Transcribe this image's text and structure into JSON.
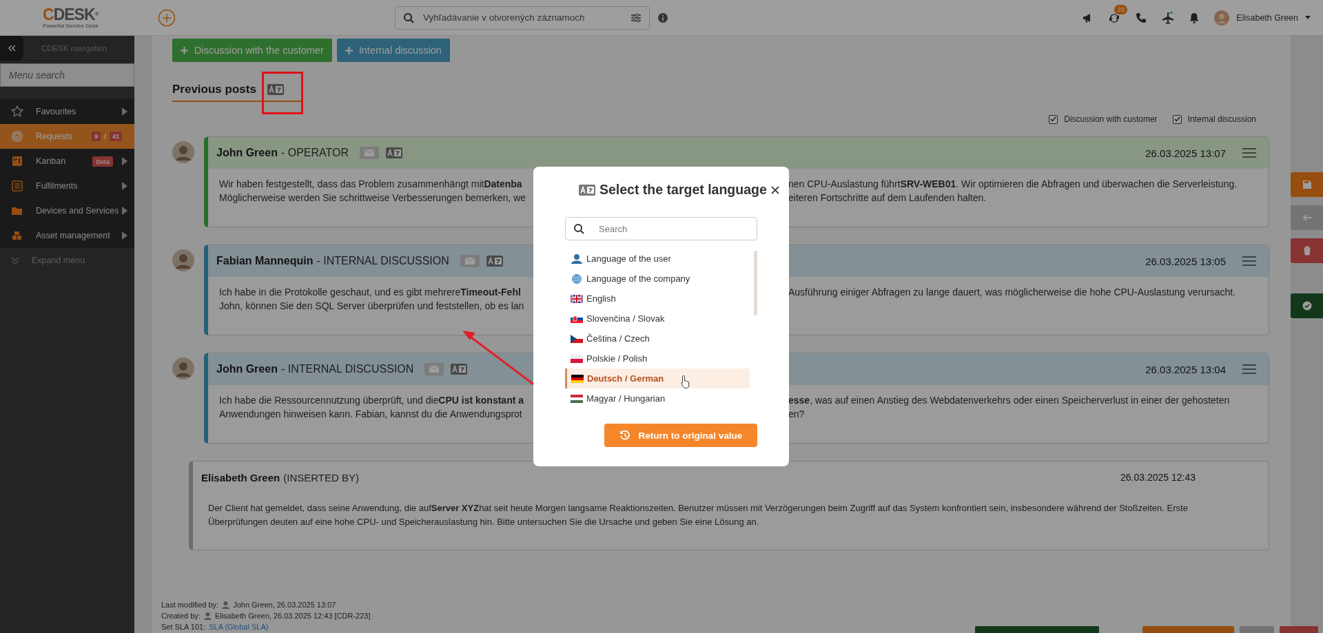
{
  "topbar": {
    "logo": {
      "accent": "C",
      "rest": "DESK",
      "mark": "®",
      "tagline": "Powerful Service Desk"
    },
    "search": {
      "placeholder": "Vyhľadávanie v otvorených záznamoch"
    },
    "sync_badge": "20",
    "user": "Elisabeth Green"
  },
  "sidebar": {
    "title": "CDESK navigation",
    "search": {
      "placeholder": "Menu search"
    },
    "items": [
      {
        "label": "Favourites",
        "kind": "star",
        "selected": false,
        "submenu": true
      },
      {
        "label": "Requests",
        "kind": "requests",
        "selected": true,
        "submenu": false,
        "counts": [
          "9",
          "/",
          "41"
        ]
      },
      {
        "label": "Kanban",
        "kind": "kanban",
        "selected": false,
        "submenu": true,
        "tag": "Beta"
      },
      {
        "label": "Fulfilments",
        "kind": "list",
        "selected": false,
        "submenu": true
      },
      {
        "label": "Devices and Services",
        "kind": "folder",
        "selected": false,
        "submenu": true
      },
      {
        "label": "Asset management",
        "kind": "boxes",
        "selected": false,
        "submenu": true
      }
    ],
    "expand": "Expand menu"
  },
  "actions": [
    {
      "label": "Discussion with the customer",
      "kind": "customer"
    },
    {
      "label": "Internal discussion",
      "kind": "internal"
    }
  ],
  "section_title": "Previous posts",
  "filters": [
    {
      "label": "Discussion with customer",
      "checked": true
    },
    {
      "label": "Internal discussion",
      "checked": true
    }
  ],
  "posts": [
    {
      "kind": "customer",
      "author": "John Green",
      "role": "- OPERATOR",
      "date": "26.03.2025 13:07",
      "lines": [
        {
          "left": "Wir haben festgestellt, dass das Problem zusammenhängt mit**Datenba**",
          "right": "nen CPU-Auslastung führt**SRV-WEB01**. Wir optimieren die Abfragen und überwachen die Serverleistung."
        },
        {
          "left": "Möglicherweise werden Sie schrittweise Verbesserungen bemerken, we",
          "right": "eiteren Fortschritte auf dem Laufenden halten."
        }
      ]
    },
    {
      "kind": "internal",
      "author": "Fabian Mannequin",
      "role": "- INTERNAL DISCUSSION",
      "date": "26.03.2025 13:05",
      "lines": [
        {
          "left": "Ich habe in die Protokolle geschaut, und es gibt mehrere**Timeout-Fehl**",
          "right": "Ausführung einiger Abfragen zu lange dauert, was möglicherweise die hohe CPU-Auslastung verursacht."
        },
        {
          "left": "John, können Sie den SQL Server überprüfen und feststellen, ob es lan"
        }
      ]
    },
    {
      "kind": "internal",
      "author": "John Green",
      "role": "- INTERNAL DISCUSSION",
      "date": "26.03.2025 13:04",
      "lines": [
        {
          "left": "Ich habe die Ressourcennutzung überprüft, und die**CPU ist konstant a**",
          "right": "**esse**, was auf einen Anstieg des Webdatenverkehrs oder einen Speicherverlust in einer der gehosteten"
        },
        {
          "left": "Anwendungen hinweisen kann. Fabian, kannst du die Anwendungsprot",
          "right": "en?"
        }
      ]
    },
    {
      "kind": "inserted",
      "author": "Elisabeth Green",
      "role": "(INSERTED BY)",
      "date": "26.03.2025 12:43",
      "text": "Der Client hat gemeldet, dass seine Anwendung, die auf**Server XYZ**hat seit heute Morgen langsame Reaktionszeiten. Benutzer müssen mit Verzögerungen beim Zugriff auf das System konfrontiert sein, insbesondere während der Stoßzeiten. Erste Überprüfungen deuten auf eine hohe CPU- und Speicherauslastung hin. Bitte untersuchen Sie die Ursache und geben Sie eine Lösung an."
    }
  ],
  "footer": [
    {
      "label": "Last modified by:",
      "value": "John Green,  26.03.2025 13:07"
    },
    {
      "label": "Created by:",
      "value": "Elisabeth Green,  26.03.2025 12:43 [CDR-223]"
    },
    {
      "label": "Set SLA 101:",
      "link": "SLA (Global SLA)"
    }
  ],
  "dialog": {
    "title": "Select the target language",
    "search": {
      "placeholder": "Search"
    },
    "languages": [
      {
        "label": "Language of the user",
        "kind": "user",
        "selected": false
      },
      {
        "label": "Language of the company",
        "kind": "globe",
        "selected": false
      },
      {
        "label": "English",
        "kind": "gb",
        "selected": false
      },
      {
        "label": "Slovenčina / Slovak",
        "kind": "sk",
        "selected": false
      },
      {
        "label": "Čeština / Czech",
        "kind": "cz",
        "selected": false
      },
      {
        "label": "Polskie / Polish",
        "kind": "pl",
        "selected": false
      },
      {
        "label": "Deutsch / German",
        "kind": "de",
        "selected": true
      },
      {
        "label": "Magyar / Hungarian",
        "kind": "hu",
        "selected": false
      }
    ],
    "reset": "Return to original value"
  }
}
